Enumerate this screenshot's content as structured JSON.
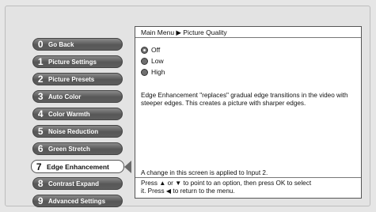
{
  "menu": {
    "items": [
      {
        "num": "0",
        "label": "Go Back"
      },
      {
        "num": "1",
        "label": "Picture Settings"
      },
      {
        "num": "2",
        "label": "Picture Presets"
      },
      {
        "num": "3",
        "label": "Auto Color"
      },
      {
        "num": "4",
        "label": "Color Warmth"
      },
      {
        "num": "5",
        "label": "Noise Reduction"
      },
      {
        "num": "6",
        "label": "Green Stretch"
      },
      {
        "num": "7",
        "label": "Edge Enhancement"
      },
      {
        "num": "8",
        "label": "Contrast Expand"
      },
      {
        "num": "9",
        "label": "Advanced Settings"
      }
    ],
    "selected_label": "Edge Enhancement"
  },
  "panel": {
    "breadcrumb": "Main Menu ▶ Picture Quality",
    "options": [
      {
        "label": "Off",
        "selected": true
      },
      {
        "label": "Low",
        "selected": false
      },
      {
        "label": "High",
        "selected": false
      }
    ],
    "description": "Edge Enhancement \"replaces\" gradual edge transitions in the video with steeper edges. This creates a picture with sharper edges.",
    "applied_note": "A change in this screen is applied to Input 2.",
    "help_line1": "Press ▲ or ▼ to point to an option, then press OK to select",
    "help_line2": "it. Press ◀ to return to the menu."
  },
  "colors": {
    "button_gradient_top": "#8a8a8a",
    "button_gradient_bottom": "#575757",
    "selected_button": "#ffffff",
    "panel_background": "#ffffff",
    "screen_background": "#e3e3e3"
  }
}
